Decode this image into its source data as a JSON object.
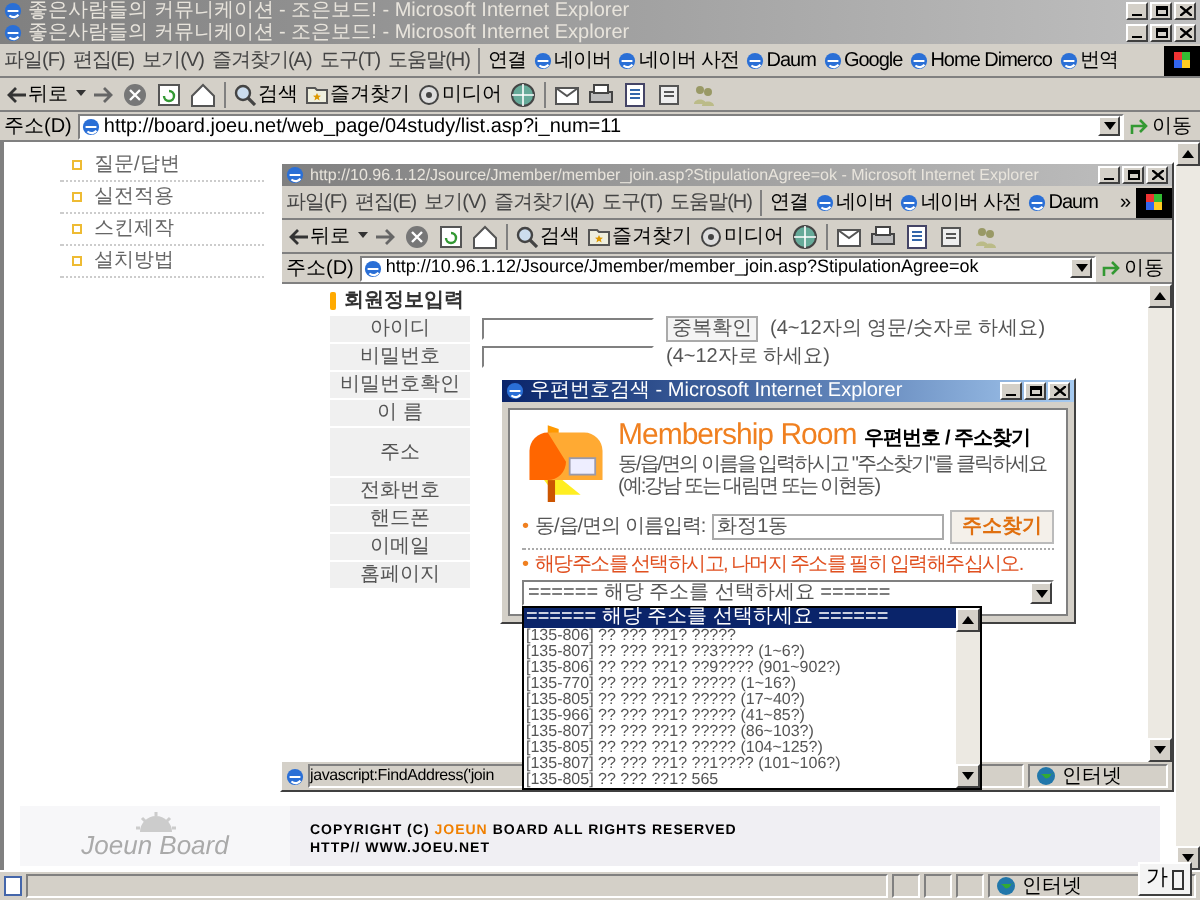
{
  "main_window": {
    "titles": [
      "좋은사람들의 커뮤니케이션 - 조은보드! - Microsoft Internet Explorer",
      "좋은사람들의 커뮤니케이션 - 조은보드! - Microsoft Internet Explorer"
    ],
    "menu": [
      "파일(F)",
      "편집(E)",
      "보기(V)",
      "즐겨찾기(A)",
      "도구(T)",
      "도움말(H)"
    ],
    "links_label": "연결",
    "links": [
      "네이버",
      "네이버 사전",
      "Daum",
      "Google",
      "Home Dimerco",
      "번역"
    ],
    "toolbar": {
      "back": "뒤로",
      "search": "검색",
      "favorites": "즐겨찾기",
      "media": "미디어"
    },
    "address_label": "주소(D)",
    "address": "http://board.joeu.net/web_page/04study/list.asp?i_num=11",
    "go": "이동",
    "nav": [
      "질문/답변",
      "실전적용",
      "스킨제작",
      "설치방법"
    ],
    "footer": {
      "logo": "Joeun Board",
      "copyright_prefix": "COPYRIGHT (C)",
      "brand": "JOEUN",
      "copyright_suffix": "BOARD ALL RIGHTS RESERVED",
      "url": "HTTP// WWW.JOEU.NET"
    },
    "status": "인터넷",
    "ime": "가"
  },
  "join_window": {
    "title": "http://10.96.1.12/Jsource/Jmember/member_join.asp?StipulationAgree=ok - Microsoft Internet Explorer",
    "menu": [
      "파일(F)",
      "편집(E)",
      "보기(V)",
      "즐겨찾기(A)",
      "도구(T)",
      "도움말(H)"
    ],
    "links_label": "연결",
    "links": [
      "네이버",
      "네이버 사전",
      "Daum"
    ],
    "more": "»",
    "toolbar": {
      "back": "뒤로",
      "search": "검색",
      "favorites": "즐겨찾기",
      "media": "미디어"
    },
    "address_label": "주소(D)",
    "address": "http://10.96.1.12/Jsource/Jmember/member_join.asp?StipulationAgree=ok",
    "go": "이동",
    "section": "회원정보입력",
    "rows": [
      {
        "label": "아이디",
        "kind": "id",
        "button": "중복확인",
        "hint": "(4~12자의 영문/숫자로 하세요)"
      },
      {
        "label": "비밀번호",
        "kind": "password",
        "hint": "(4~12자로 하세요)"
      },
      {
        "label": "비밀번호확인",
        "kind": "plain"
      },
      {
        "label": "이 름",
        "kind": "plain"
      },
      {
        "label": "주소",
        "kind": "address"
      },
      {
        "label": "전화번호",
        "kind": "plain"
      },
      {
        "label": "핸드폰",
        "kind": "plain"
      },
      {
        "label": "이메일",
        "kind": "plain"
      },
      {
        "label": "홈페이지",
        "kind": "plain"
      }
    ],
    "status": "javascript:FindAddress('join",
    "zone": "인터넷"
  },
  "popup": {
    "title": "우편번호검색 - Microsoft Internet Explorer",
    "bullet": "•",
    "brand": "Membership Room",
    "heading": "우편번호 / 주소찾기",
    "instructions": [
      "동/읍/면의 이름을 입력하시고 \"주소찾기\"를 클릭하세요",
      "(예:강남 또는 대림면 또는 이현동)"
    ],
    "search_label": "동/읍/면의 이름입력:",
    "search_value": "화정1동",
    "search_button": "주소찾기",
    "notice": "해당주소를 선택하시고, 나머지 주소를 필히 입력해주십시오.",
    "select_value": "====== 해당 주소를 선택하세요 ======",
    "options": [
      {
        "text": "====== 해당 주소를 선택하세요 ======",
        "selected": true
      },
      {
        "text": "[135-806] ?? ??? ??1? ?????",
        "selected": false
      },
      {
        "text": "[135-807] ?? ??? ??1? ??3???? (1~6?)",
        "selected": false
      },
      {
        "text": "[135-806] ?? ??? ??1? ??9???? (901~902?)",
        "selected": false
      },
      {
        "text": "[135-770] ?? ??? ??1? ????? (1~16?)",
        "selected": false
      },
      {
        "text": "[135-805] ?? ??? ??1? ????? (17~40?)",
        "selected": false
      },
      {
        "text": "[135-966] ?? ??? ??1? ????? (41~85?)",
        "selected": false
      },
      {
        "text": "[135-807] ?? ??? ??1? ????? (86~103?)",
        "selected": false
      },
      {
        "text": "[135-805] ?? ??? ??1? ????? (104~125?)",
        "selected": false
      },
      {
        "text": "[135-807] ?? ??? ??1? ??1???? (101~106?)",
        "selected": false
      },
      {
        "text": "[135-805] ?? ??? ??1? 565",
        "selected": false
      }
    ]
  }
}
